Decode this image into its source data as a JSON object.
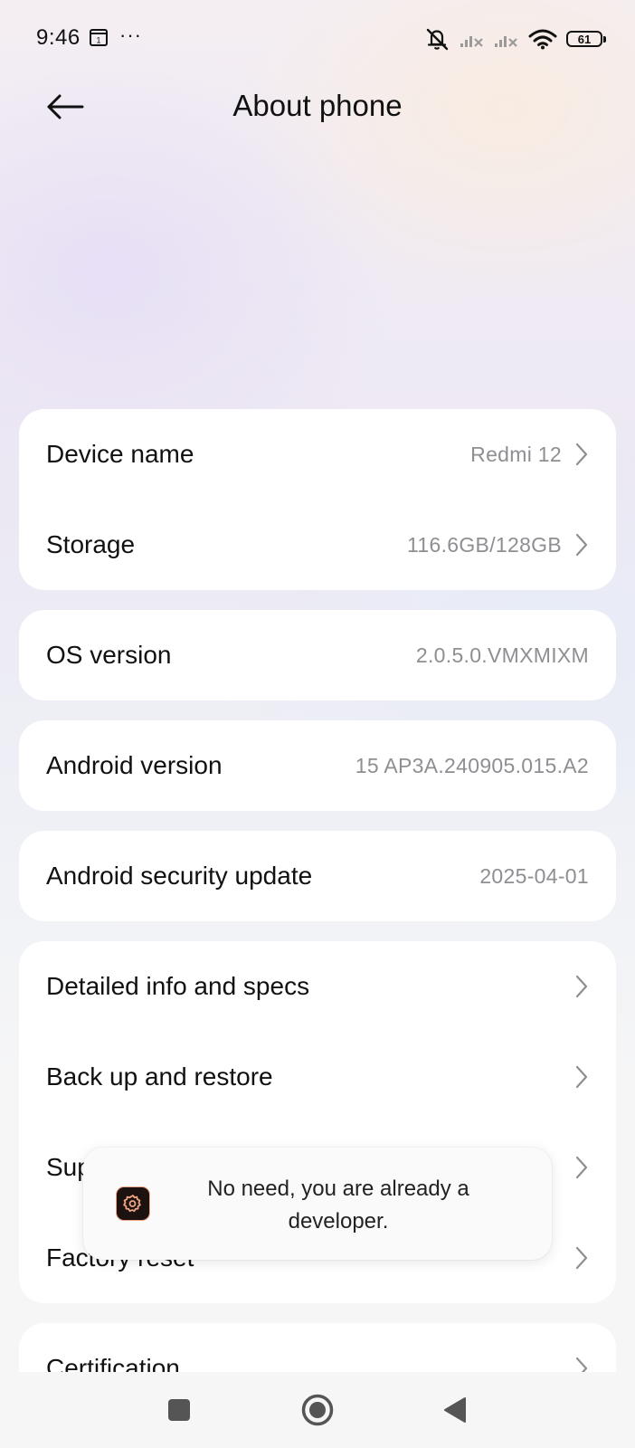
{
  "status_bar": {
    "time": "9:46",
    "calendar_day": "1",
    "more": "···",
    "battery": "61"
  },
  "header": {
    "title": "About phone"
  },
  "card1": {
    "device_name": {
      "label": "Device name",
      "value": "Redmi 12"
    },
    "storage": {
      "label": "Storage",
      "value": "116.6GB/128GB"
    }
  },
  "os_version": {
    "label": "OS version",
    "value": "2.0.5.0.VMXMIXM"
  },
  "android_version": {
    "label": "Android version",
    "value": "15 AP3A.240905.015.A2"
  },
  "security_update": {
    "label": "Android security update",
    "value": "2025-04-01"
  },
  "card5": {
    "detailed_info": "Detailed info and specs",
    "backup": "Back up and restore",
    "support": "Sup",
    "factory_reset": "Factory reset"
  },
  "card6": {
    "certification": "Certification"
  },
  "toast": {
    "message": "No need, you are already a developer."
  },
  "colors": {
    "value_text": "#8e8e93",
    "label_text": "#111111",
    "card_bg": "#ffffff",
    "toast_icon_accent": "#f2a483"
  }
}
